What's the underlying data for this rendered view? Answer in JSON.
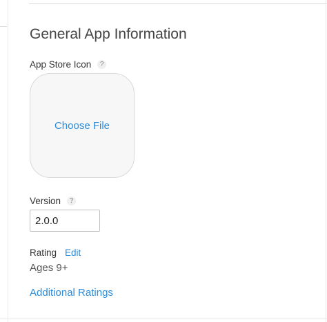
{
  "section": {
    "title": "General App Information"
  },
  "app_store_icon": {
    "label": "App Store Icon",
    "help": "?",
    "choose_file": "Choose File"
  },
  "version": {
    "label": "Version",
    "help": "?",
    "value": "2.0.0"
  },
  "rating": {
    "label": "Rating",
    "edit": "Edit",
    "value": "Ages 9+",
    "additional": "Additional Ratings"
  },
  "colors": {
    "link": "#2a8cdb",
    "text": "#333333",
    "well_bg": "#f7f7f7",
    "border": "#d9d9d9"
  }
}
